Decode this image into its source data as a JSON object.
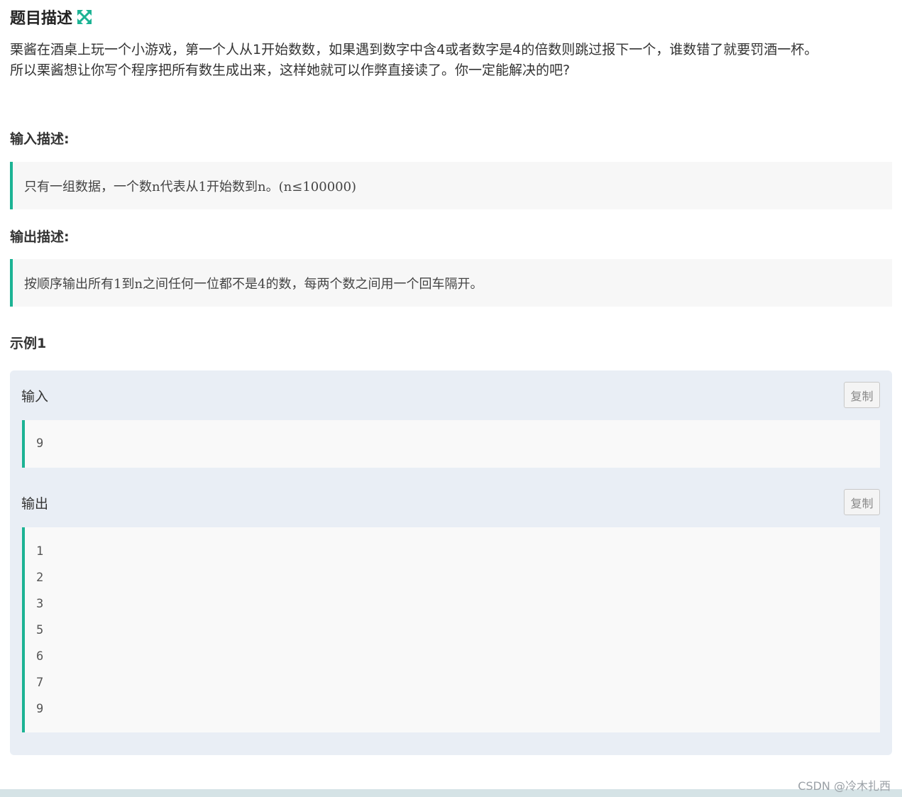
{
  "problem": {
    "title": "题目描述",
    "description_lines": [
      "栗酱在酒桌上玩一个小游戏，第一个人从1开始数数，如果遇到数字中含4或者数字是4的倍数则跳过报下一个，谁数错了就要罚酒一杯。",
      "所以栗酱想让你写个程序把所有数生成出来，这样她就可以作弊直接读了。你一定能解决的吧?"
    ]
  },
  "input_section": {
    "heading": "输入描述:",
    "text": "只有一组数据，一个数n代表从1开始数到n。(n≤100000)"
  },
  "output_section": {
    "heading": "输出描述:",
    "text": "按顺序输出所有1到n之间任何一位都不是4的数，每两个数之间用一个回车隔开。"
  },
  "example": {
    "heading": "示例1",
    "input_label": "输入",
    "output_label": "输出",
    "copy_label": "复制",
    "input_lines": [
      "9"
    ],
    "output_lines": [
      "1",
      "2",
      "3",
      "5",
      "6",
      "7",
      "9"
    ]
  },
  "watermark": "CSDN @冷木扎西",
  "colors": {
    "accent": "#1cb394",
    "example_bg": "#e9eef5",
    "code_bg": "#f9f9f9"
  },
  "icons": {
    "title_icon": "expand-arrows-icon"
  }
}
